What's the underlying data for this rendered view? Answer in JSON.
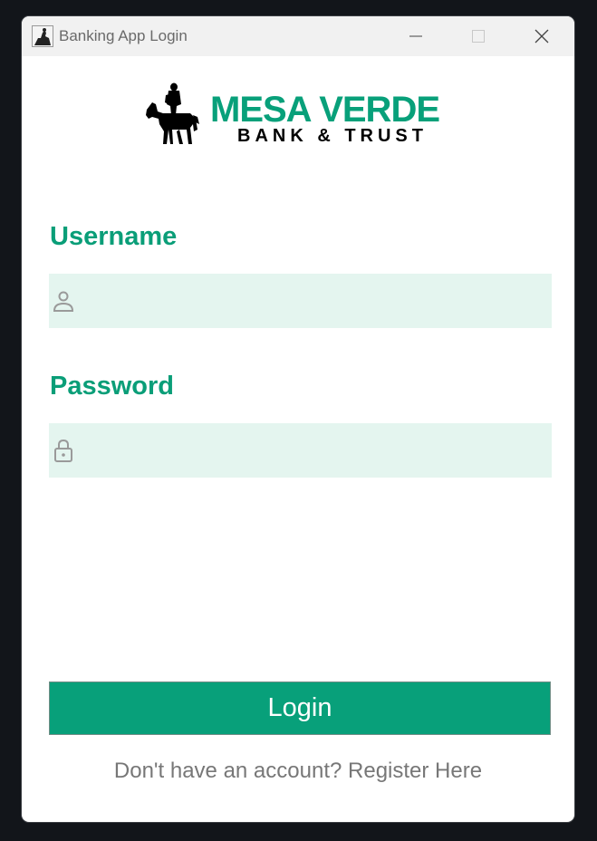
{
  "window": {
    "title": "Banking App Login",
    "controls": {
      "minimize_icon": "minimize-icon",
      "maximize_icon": "maximize-icon",
      "close_icon": "close-icon"
    }
  },
  "logo": {
    "brand_name": "MESA VERDE",
    "brand_sub": "BANK & TRUST",
    "emblem": "horse-rider-icon"
  },
  "form": {
    "username": {
      "label": "Username",
      "value": "",
      "placeholder": "",
      "icon": "user-icon"
    },
    "password": {
      "label": "Password",
      "value": "",
      "placeholder": "",
      "icon": "lock-icon"
    },
    "login_label": "Login"
  },
  "register": {
    "prompt": "Don't have an account?",
    "link": "Register Here"
  },
  "colors": {
    "accent": "#08a07a",
    "field_bg": "#e4f5ef",
    "label": "#0a9e78",
    "muted_text": "#777777"
  }
}
